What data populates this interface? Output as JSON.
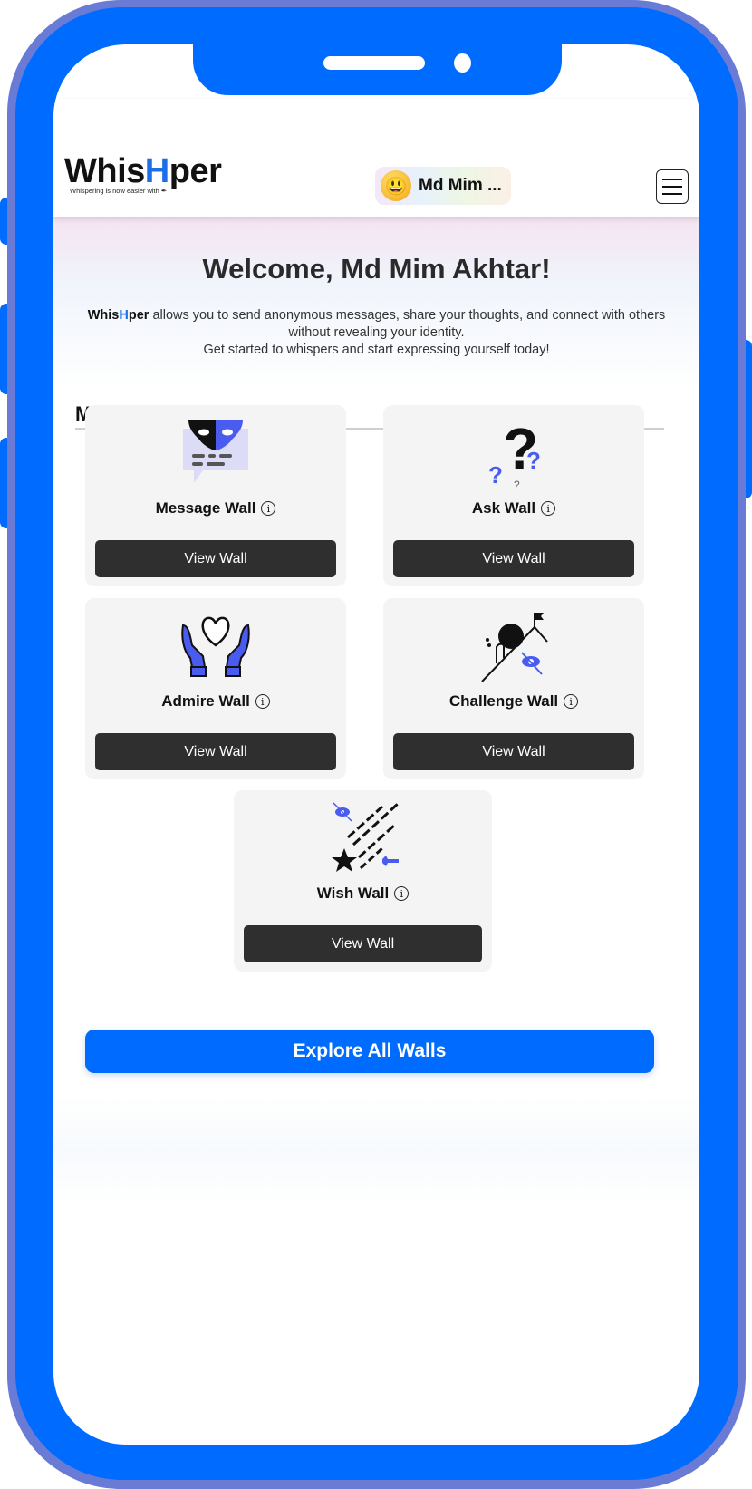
{
  "device": {
    "frame_color": "#006cff",
    "frame_edge_color": "#6a7bd6"
  },
  "header": {
    "logo": {
      "prefix": "Whis",
      "highlight": "H",
      "suffix": "per",
      "tagline": "Whispering is now easier with ✒"
    },
    "user_chip": {
      "avatar_icon": "smiley-emoji-icon",
      "avatar_glyph": "😃",
      "name": "Md Mim ..."
    },
    "menu_icon": "hamburger-menu-icon"
  },
  "hero": {
    "welcome": "Welcome, Md Mim Akhtar!",
    "brand_prefix": "Whis",
    "brand_highlight": "H",
    "brand_suffix": "per",
    "intro_line1": " allows you to send anonymous messages, share your thoughts, and connect with others without revealing your identity.",
    "intro_line2": "Get started to whispers and start expressing yourself today!"
  },
  "walls_section": {
    "title": "My Active Walls",
    "walls": [
      {
        "name": "Message Wall",
        "icon": "masked-message-icon",
        "button": "View Wall",
        "info_glyph": "i"
      },
      {
        "name": "Ask Wall",
        "icon": "question-marks-icon",
        "button": "View Wall",
        "info_glyph": "i"
      },
      {
        "name": "Admire Wall",
        "icon": "hands-heart-icon",
        "button": "View Wall",
        "info_glyph": "i"
      },
      {
        "name": "Challenge Wall",
        "icon": "boulder-climb-icon",
        "button": "View Wall",
        "info_glyph": "i"
      },
      {
        "name": "Wish Wall",
        "icon": "shooting-star-icon",
        "button": "View Wall",
        "info_glyph": "i"
      }
    ]
  },
  "explore_button": "Explore All Walls",
  "colors": {
    "brand_blue": "#006cff",
    "logo_h": "#1d6fe8",
    "dark_button": "#2f2f2f",
    "card_bg": "#f4f4f4",
    "icon_accent": "#4a5cf0"
  }
}
